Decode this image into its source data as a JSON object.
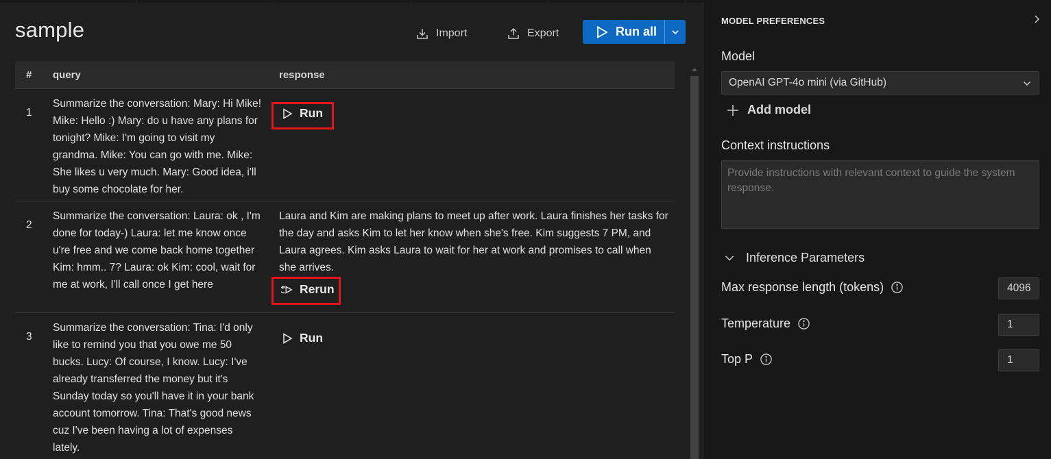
{
  "page": {
    "title": "sample"
  },
  "toolbar": {
    "import_label": "Import",
    "export_label": "Export",
    "run_all_label": "Run all"
  },
  "table": {
    "headers": {
      "index": "#",
      "query": "query",
      "response": "response"
    },
    "rows": [
      {
        "index": "1",
        "query": "Summarize the conversation: Mary: Hi Mike! Mike: Hello :) Mary: do u have any plans for tonight? Mike: I'm going to visit my grandma. Mike: You can go with me. Mike: She likes u very much. Mary: Good idea, i'll buy some chocolate for her.",
        "response": "",
        "action_label": "Run"
      },
      {
        "index": "2",
        "query": "Summarize the conversation: Laura: ok , I'm done for today-) Laura: let me know once u're free and we come back home together Kim: hmm.. 7? Laura: ok Kim: cool, wait for me at work, I'll call once I get here",
        "response": "Laura and Kim are making plans to meet up after work. Laura finishes her tasks for the day and asks Kim to let her know when she's free. Kim suggests 7 PM, and Laura agrees. Kim asks Laura to wait for her at work and promises to call when she arrives.",
        "action_label": "Rerun"
      },
      {
        "index": "3",
        "query": "Summarize the conversation: Tina: I'd only like to remind you that you owe me 50 bucks. Lucy: Of course, I know. Lucy: I've already transferred the money but it's Sunday today so you'll have it in your bank account tomorrow. Tina: That's good news cuz I've been having a lot of expenses lately.",
        "response": "",
        "action_label": "Run"
      }
    ]
  },
  "sidebar": {
    "title": "MODEL PREFERENCES",
    "model_label": "Model",
    "model_value": "OpenAI GPT-4o mini (via GitHub)",
    "add_model_label": "Add model",
    "context_label": "Context instructions",
    "context_placeholder": "Provide instructions with relevant context to guide the system response.",
    "inference_label": "Inference Parameters",
    "params": [
      {
        "label": "Max response length (tokens)",
        "value": "4096"
      },
      {
        "label": "Temperature",
        "value": "1"
      },
      {
        "label": "Top P",
        "value": "1"
      }
    ]
  },
  "colors": {
    "accent": "#0e69c2",
    "highlight": "#e3151b",
    "background": "#1f1f1f",
    "panel": "#181818"
  },
  "icons": [
    "import-icon",
    "export-icon",
    "play-icon",
    "chevron-down-icon",
    "rerun-icon",
    "chevron-right-icon",
    "plus-icon",
    "info-icon"
  ]
}
